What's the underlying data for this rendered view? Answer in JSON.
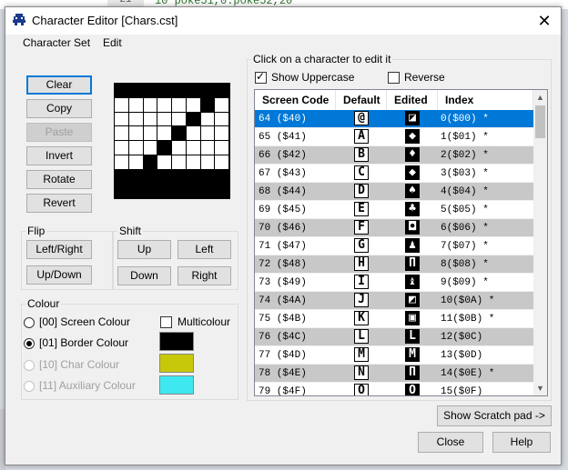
{
  "background": {
    "line_number": "21",
    "code": "10 poke51,0:poke52,20"
  },
  "window": {
    "title": "Character Editor [Chars.cst]",
    "close_glyph": "✕"
  },
  "menu": {
    "items": [
      "Character Set",
      "Edit"
    ]
  },
  "edit_buttons": {
    "clear": "Clear",
    "copy": "Copy",
    "paste": "Paste",
    "invert": "Invert",
    "rotate": "Rotate",
    "revert": "Revert"
  },
  "pixel_grid": [
    [
      1,
      1,
      1,
      1,
      1,
      1,
      1,
      1
    ],
    [
      0,
      0,
      0,
      0,
      0,
      0,
      1,
      0
    ],
    [
      0,
      0,
      0,
      0,
      0,
      1,
      0,
      0
    ],
    [
      0,
      0,
      0,
      0,
      1,
      0,
      0,
      0
    ],
    [
      0,
      0,
      0,
      1,
      0,
      0,
      0,
      0
    ],
    [
      0,
      0,
      1,
      0,
      0,
      0,
      0,
      0
    ],
    [
      1,
      1,
      1,
      1,
      1,
      1,
      1,
      1
    ],
    [
      1,
      1,
      1,
      1,
      1,
      1,
      1,
      1
    ]
  ],
  "flip": {
    "label": "Flip",
    "left_right": "Left/Right",
    "up_down": "Up/Down"
  },
  "shift": {
    "label": "Shift",
    "up": "Up",
    "left": "Left",
    "down": "Down",
    "right": "Right"
  },
  "colour": {
    "label": "Colour",
    "options": [
      "[00] Screen Colour",
      "[01] Border Colour",
      "[10] Char Colour",
      "[11] Auxiliary Colour"
    ],
    "selected_index": 1,
    "multicolour_label": "Multicolour",
    "multicolour_checked": false,
    "swatches": [
      "#000000",
      "#c8c80a",
      "#3fe8f0"
    ]
  },
  "charlist": {
    "label": "Click on a character to edit it",
    "show_uppercase_label": "Show Uppercase",
    "show_uppercase_checked": true,
    "reverse_label": "Reverse",
    "reverse_checked": false,
    "columns": [
      "Screen Code",
      "Default",
      "Edited",
      "Index"
    ],
    "rows": [
      {
        "code": "64 ($40)",
        "def": "@",
        "edit": "◪",
        "index": "0($00) *",
        "sel": true
      },
      {
        "code": "65 ($41)",
        "def": "A",
        "edit": "◆",
        "index": "1($01) *"
      },
      {
        "code": "66 ($42)",
        "def": "B",
        "edit": "♦",
        "index": "2($02) *"
      },
      {
        "code": "67 ($43)",
        "def": "C",
        "edit": "◆",
        "index": "3($03) *"
      },
      {
        "code": "68 ($44)",
        "def": "D",
        "edit": "♠",
        "index": "4($04) *"
      },
      {
        "code": "69 ($45)",
        "def": "E",
        "edit": "♣",
        "index": "5($05) *"
      },
      {
        "code": "70 ($46)",
        "def": "F",
        "edit": "◘",
        "index": "6($06) *"
      },
      {
        "code": "71 ($47)",
        "def": "G",
        "edit": "♟",
        "index": "7($07) *"
      },
      {
        "code": "72 ($48)",
        "def": "H",
        "edit": "Π",
        "index": "8($08) *"
      },
      {
        "code": "73 ($49)",
        "def": "I",
        "edit": "♝",
        "index": "9($09) *"
      },
      {
        "code": "74 ($4A)",
        "def": "J",
        "edit": "◩",
        "index": "10($0A) *"
      },
      {
        "code": "75 ($4B)",
        "def": "K",
        "edit": "▣",
        "index": "11($0B) *"
      },
      {
        "code": "76 ($4C)",
        "def": "L",
        "edit": "L",
        "index": "12($0C)"
      },
      {
        "code": "77 ($4D)",
        "def": "M",
        "edit": "M",
        "index": "13($0D)"
      },
      {
        "code": "78 ($4E)",
        "def": "N",
        "edit": "Π",
        "index": "14($0E) *"
      },
      {
        "code": "79 ($4F)",
        "def": "O",
        "edit": "O",
        "index": "15($0F)"
      }
    ]
  },
  "scratch_button": "Show Scratch pad ->",
  "close_button": "Close",
  "help_button": "Help"
}
